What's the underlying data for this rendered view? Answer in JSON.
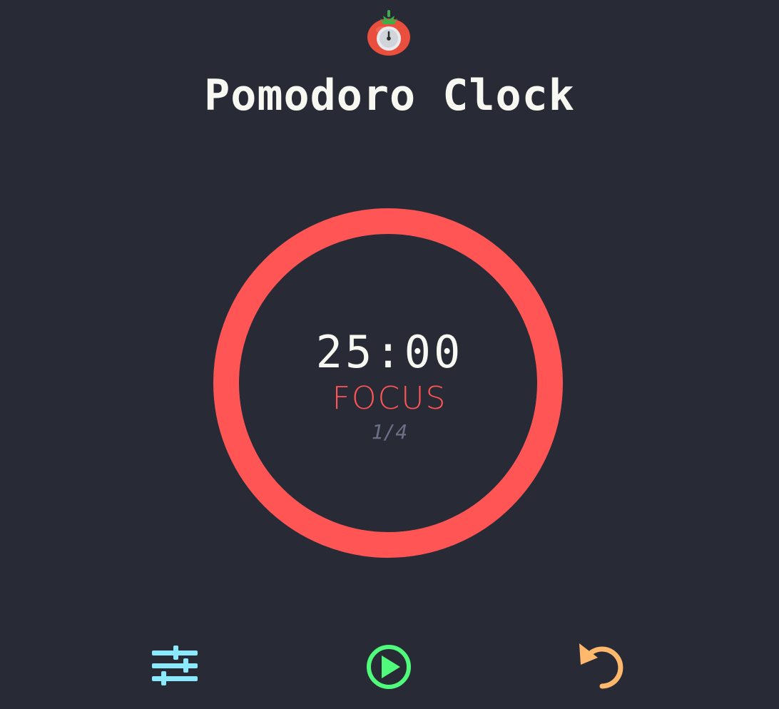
{
  "app": {
    "title": "Pomodoro Clock",
    "logo_icon": "tomato-timer-icon"
  },
  "timer": {
    "time": "25:00",
    "mode": "FOCUS",
    "round": "1/4",
    "progress": 1.0,
    "ring_color": "#ff5555"
  },
  "controls": {
    "settings_icon": "sliders-icon",
    "play_icon": "play-icon",
    "reset_icon": "reset-icon",
    "settings_color": "#8be9fd",
    "play_color": "#50fa7b",
    "reset_color": "#ffb86c"
  },
  "theme": {
    "background": "#282a36",
    "text": "#f8f8f2",
    "muted": "#6c7086"
  }
}
